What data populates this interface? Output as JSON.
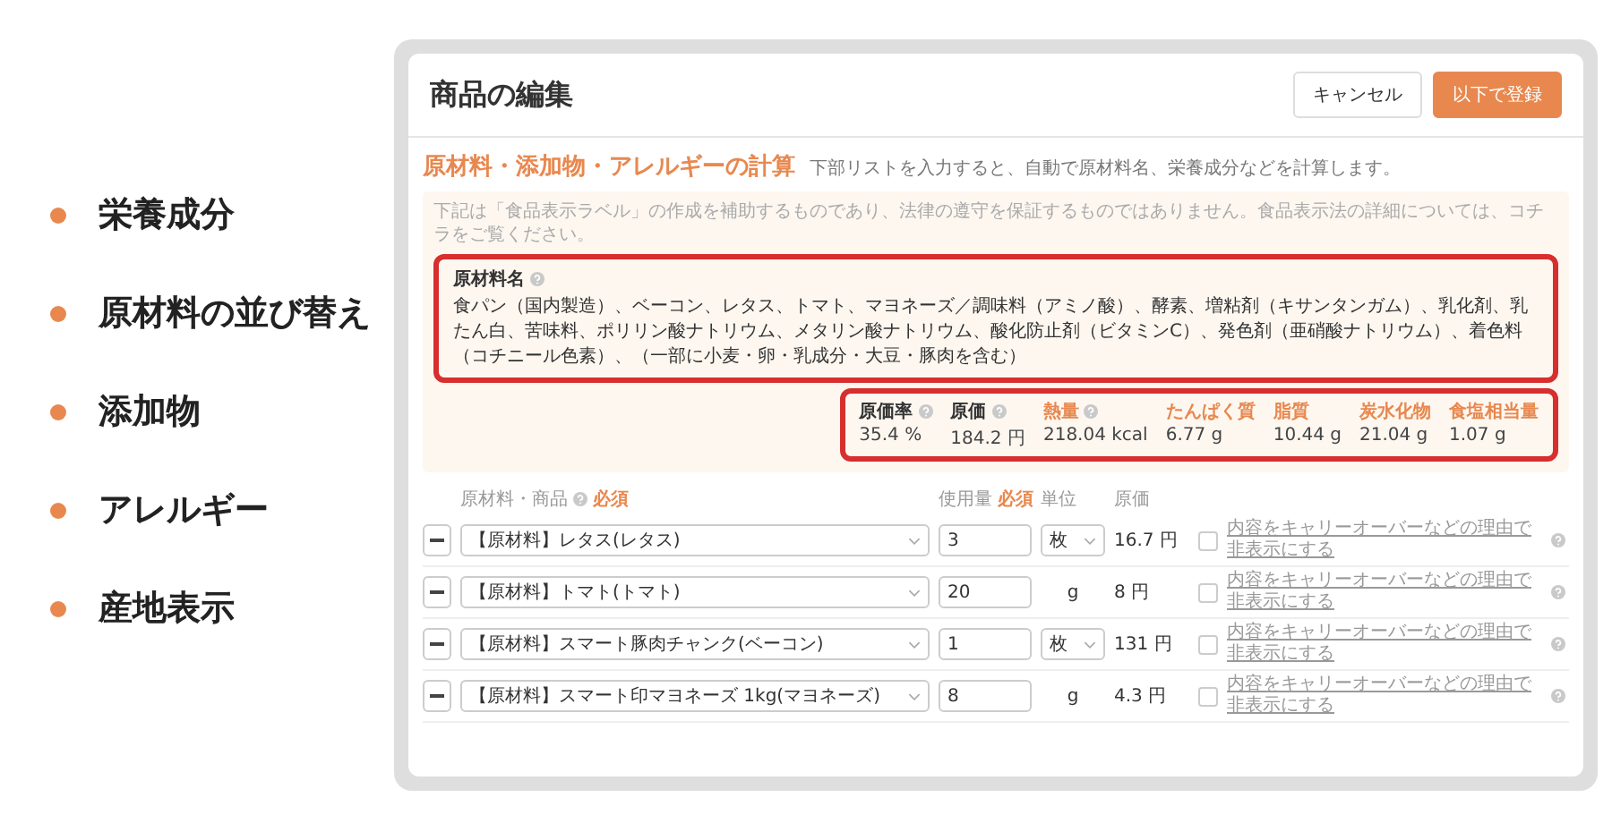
{
  "features": [
    "栄養成分",
    "原材料の並び替え",
    "添加物",
    "アレルギー",
    "産地表示"
  ],
  "screen": {
    "title": "商品の編集",
    "buttons": [
      {
        "label": "キャンセル",
        "kind": "secondary"
      },
      {
        "label": "以下で登録",
        "kind": "primary"
      }
    ],
    "section": {
      "title": "原材料・添加物・アレルギーの計算",
      "hint": "下部リストを入力すると、自動で原材料名、栄養成分などを計算します。"
    },
    "notice": "下記は「食品表示ラベル」の作成を補助するものであり、法律の遵守を保証するものではありません。食品表示法の詳細については、コチラをご覧ください。",
    "ingredients": {
      "label": "原材料名",
      "help": true,
      "text": "食パン（国内製造）、ベーコン、レタス、トマト、マヨネーズ／調味料（アミノ酸）、酵素、増粘剤（キサンタンガム）、乳化剤、乳たん白、苦味料、ポリリン酸ナトリウム、メタリン酸ナトリウム、酸化防止剤（ビタミンC）、発色剤（亜硝酸ナトリウム）、着色料（コチニール色素）、（一部に小麦・卵・乳成分・大豆・豚肉を含む）"
    },
    "stats": [
      {
        "label": "原価率",
        "value": "35.4 %",
        "color": "#333333",
        "help": true
      },
      {
        "label": "原価",
        "value": "184.2 円",
        "color": "#333333",
        "help": true
      },
      {
        "label": "熱量",
        "value": "218.04 kcal",
        "color": "#e8884f",
        "help": true
      },
      {
        "label": "たんぱく質",
        "value": "6.77 g",
        "color": "#e8884f",
        "help": false
      },
      {
        "label": "脂質",
        "value": "10.44 g",
        "color": "#e8884f",
        "help": false
      },
      {
        "label": "炭水化物",
        "value": "21.04 g",
        "color": "#e8884f",
        "help": false
      },
      {
        "label": "食塩相当量",
        "value": "1.07 g",
        "color": "#e8884f",
        "help": false
      }
    ],
    "table": {
      "columns": [
        {
          "label": "原材料・商品",
          "help": true,
          "required": "必須"
        },
        {
          "label": "使用量",
          "help": false,
          "required": "必須"
        },
        {
          "label": "単位",
          "help": false
        },
        {
          "label": "原価",
          "help": false
        }
      ],
      "rows": [
        {
          "material": "【原材料】レタス(レタス)",
          "amount": "3",
          "unit": "枚",
          "kind": "select",
          "cost": "16.7 円",
          "checked": false,
          "hide_label": "内容をキャリーオーバーなどの理由で非表示にする"
        },
        {
          "material": "【原材料】トマト(トマト)",
          "amount": "20",
          "unit": "g",
          "kind": "text",
          "cost": "8 円",
          "checked": false,
          "hide_label": "内容をキャリーオーバーなどの理由で非表示にする"
        },
        {
          "material": "【原材料】スマート豚肉チャンク(ベーコン)",
          "amount": "1",
          "unit": "枚",
          "kind": "select",
          "cost": "131 円",
          "checked": false,
          "hide_label": "内容をキャリーオーバーなどの理由で非表示にする"
        },
        {
          "material": "【原材料】スマート印マヨネーズ 1kg(マヨネーズ)",
          "amount": "8",
          "unit": "g",
          "kind": "text",
          "cost": "4.3 円",
          "checked": false,
          "hide_label": "内容をキャリーオーバーなどの理由で非表示にする"
        }
      ]
    }
  }
}
